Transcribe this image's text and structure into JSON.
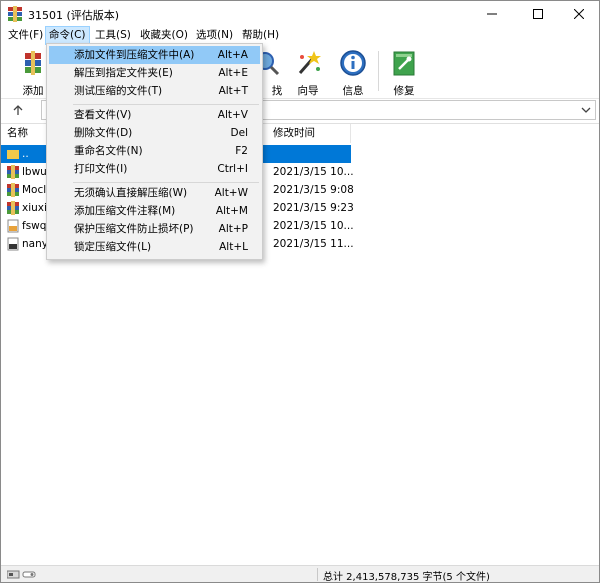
{
  "window": {
    "title": "31501 (评估版本)"
  },
  "menubar": {
    "items": [
      {
        "label": "文件(F)"
      },
      {
        "label": "命令(C)"
      },
      {
        "label": "工具(S)"
      },
      {
        "label": "收藏夹(O)"
      },
      {
        "label": "选项(N)"
      },
      {
        "label": "帮助(H)"
      }
    ]
  },
  "toolbar": {
    "buttons": [
      {
        "label": "添加",
        "icon": "add-archive-icon"
      },
      {
        "label": "找",
        "icon": "find-icon"
      },
      {
        "label": "向导",
        "icon": "wizard-icon"
      },
      {
        "label": "信息",
        "icon": "info-icon"
      },
      {
        "label": "修复",
        "icon": "repair-icon"
      }
    ]
  },
  "filelist": {
    "columns": [
      {
        "label": "名称"
      },
      {
        "label": "修改时间"
      }
    ],
    "rows": [
      {
        "name": "..",
        "modified": "",
        "selected": true
      },
      {
        "name": "lbwuy",
        "modified": "2021/3/15 10..."
      },
      {
        "name": "Mocl",
        "modified": "2021/3/15 9:08"
      },
      {
        "name": "xiuxiu",
        "modified": "2021/3/15 9:23"
      },
      {
        "name": "fswq",
        "modified": "2021/3/15 10..."
      },
      {
        "name": "nany",
        "modified": "2021/3/15 11..."
      }
    ]
  },
  "command_menu": {
    "items": [
      {
        "label": "添加文件到压缩文件中(A)",
        "shortcut": "Alt+A",
        "highlighted": true
      },
      {
        "label": "解压到指定文件夹(E)",
        "shortcut": "Alt+E"
      },
      {
        "label": "测试压缩的文件(T)",
        "shortcut": "Alt+T"
      },
      {
        "label": "查看文件(V)",
        "shortcut": "Alt+V"
      },
      {
        "label": "删除文件(D)",
        "shortcut": "Del"
      },
      {
        "label": "重命名文件(N)",
        "shortcut": "F2"
      },
      {
        "label": "打印文件(I)",
        "shortcut": "Ctrl+I"
      },
      {
        "label": "无须确认直接解压缩(W)",
        "shortcut": "Alt+W"
      },
      {
        "label": "添加压缩文件注释(M)",
        "shortcut": "Alt+M"
      },
      {
        "label": "保护压缩文件防止损坏(P)",
        "shortcut": "Alt+P"
      },
      {
        "label": "锁定压缩文件(L)",
        "shortcut": "Alt+L"
      }
    ]
  },
  "statusbar": {
    "text": "总计 2,413,578,735 字节(5 个文件)"
  },
  "colors": {
    "accent": "#0078d7",
    "menu_highlight": "#91c9f7",
    "menu_active": "#cce8ff"
  }
}
